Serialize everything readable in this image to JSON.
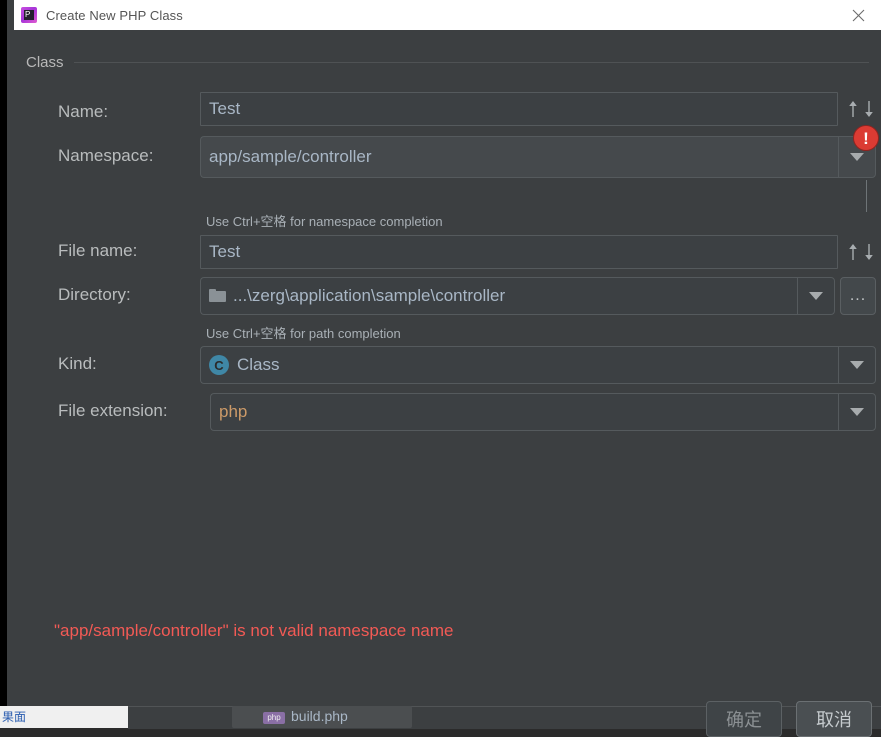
{
  "window": {
    "title": "Create New PHP Class",
    "app_icon": "phpstorm-icon",
    "close_icon": "close-icon"
  },
  "group": {
    "title": "Class"
  },
  "form": {
    "rows": [
      {
        "label": "Name:",
        "value": "Test",
        "field_name": "name-input",
        "trailing_icon": "sort-up-down-icon"
      },
      {
        "label": "Namespace:",
        "value": "app/sample/controller",
        "field_name": "namespace-input",
        "trailing_icon": "chevron-down-icon",
        "hint": "Use Ctrl+空格 for namespace completion",
        "has_error": true
      },
      {
        "label": "File name:",
        "value": "Test",
        "field_name": "file-name-input",
        "trailing_icon": "sort-up-down-icon"
      },
      {
        "label": "Directory:",
        "value": "...\\zerg\\application\\sample\\controller",
        "field_name": "directory-input",
        "leading_icon": "folder-icon",
        "trailing_icon": "chevron-down-icon",
        "browse_label": "...",
        "hint": "Use Ctrl+空格 for path completion"
      },
      {
        "label": "Kind:",
        "value": "Class",
        "field_name": "kind-select",
        "leading_icon": "class-icon",
        "icon_letter": "C",
        "trailing_icon": "chevron-down-icon"
      },
      {
        "label": "File extension:",
        "value": "php",
        "field_name": "file-extension-select",
        "trailing_icon": "chevron-down-icon"
      }
    ]
  },
  "validation": {
    "message": "\"app/sample/controller\" is not valid namespace name",
    "badge_glyph": "!",
    "color": "#f25a55"
  },
  "buttons": {
    "ok": "确定",
    "cancel": "取消"
  },
  "background": {
    "file_tab": "build.php",
    "file_badge": "php",
    "left_label": "果面"
  },
  "colors": {
    "dialog_bg": "#3c3f41",
    "field_bg": "#3c4043",
    "field_bg_focus": "#45494c",
    "text": "#a9b7c6",
    "label": "#b9bcbd",
    "error": "#f25a55",
    "accent_icon": "#3f87a6",
    "title_bar": "#ffffff"
  }
}
